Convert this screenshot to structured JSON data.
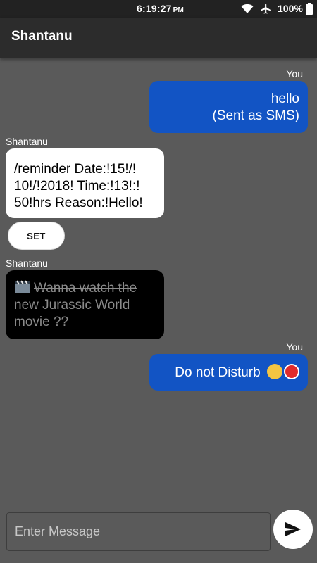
{
  "status_bar": {
    "time": "6:19:27",
    "ampm": "PM",
    "battery": "100%",
    "icons": [
      "wifi-icon",
      "airplane-icon",
      "battery-icon"
    ]
  },
  "app_bar": {
    "title": "Shantanu"
  },
  "messages": [
    {
      "sender": "You",
      "lines": [
        "hello",
        "(Sent as SMS)"
      ],
      "direction": "outgoing"
    },
    {
      "sender": "Shantanu",
      "lines": [
        "/reminder Date:!15!/!",
        "10!/!2018! Time:!13!:!",
        "50!hrs Reason:!Hello!"
      ],
      "direction": "incoming",
      "action": "SET"
    },
    {
      "sender": "Shantanu",
      "lines": [
        "Wanna watch the",
        "new Jurassic World",
        "movie ?? "
      ],
      "direction": "incoming",
      "style": "strikethrough",
      "icons": [
        "clapper-board-icon"
      ]
    },
    {
      "sender": "You",
      "lines": [
        "Do not Disturb "
      ],
      "direction": "outgoing",
      "icons": [
        "laughing-emoji-icon",
        "stop-sign-icon"
      ]
    }
  ],
  "composer": {
    "placeholder": "Enter Message",
    "value": ""
  },
  "colors": {
    "background": "#5a5a5a",
    "outgoing_bubble": "#1254c4",
    "incoming_bubble": "#ffffff",
    "app_bar": "#2c2c2c"
  }
}
